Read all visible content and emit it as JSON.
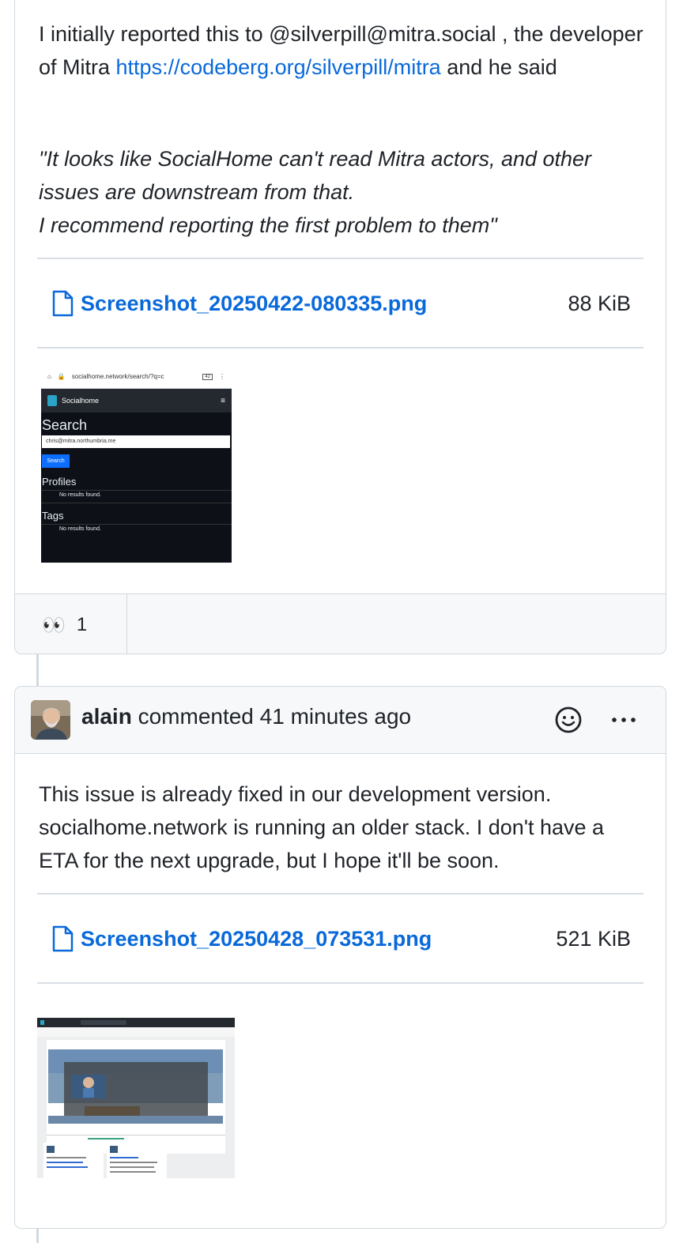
{
  "comment1": {
    "body_prefix": "I initially reported this to @silverpill@mitra.social , the developer of Mitra ",
    "link": "https://codeberg.org/silverpill/mitra",
    "body_suffix": " and he said",
    "quote_line1": "\"It looks like SocialHome can't read Mitra actors, and other issues are downstream from that.",
    "quote_line2": "I recommend reporting the first problem to them\"",
    "attachment": {
      "name": "Screenshot_20250422-080335.png",
      "size": "88 KiB"
    },
    "thumbnail": {
      "url": "socialhome.network/search/?q=c",
      "tab_count": "42",
      "app_name": "Socialhome",
      "heading": "Search",
      "query": "chris@mitra.northumbria.me",
      "button": "Search",
      "profiles": "Profiles",
      "profiles_result": "No results found.",
      "tags": "Tags",
      "tags_result": "No results found."
    },
    "reaction": {
      "emoji": "👀",
      "count": "1"
    }
  },
  "comment2": {
    "author": "alain",
    "action": "commented",
    "time": "41 minutes ago",
    "body": "This issue is already fixed in our development version. socialhome.network is running an older stack. I don't have a ETA for the next upgrade, but I hope it'll be soon.",
    "attachment": {
      "name": "Screenshot_20250428_073531.png",
      "size": "521 KiB"
    }
  },
  "icons": [
    "file-icon",
    "smiley-icon",
    "kebab-menu-icon",
    "eyes-emoji",
    "avatar"
  ]
}
